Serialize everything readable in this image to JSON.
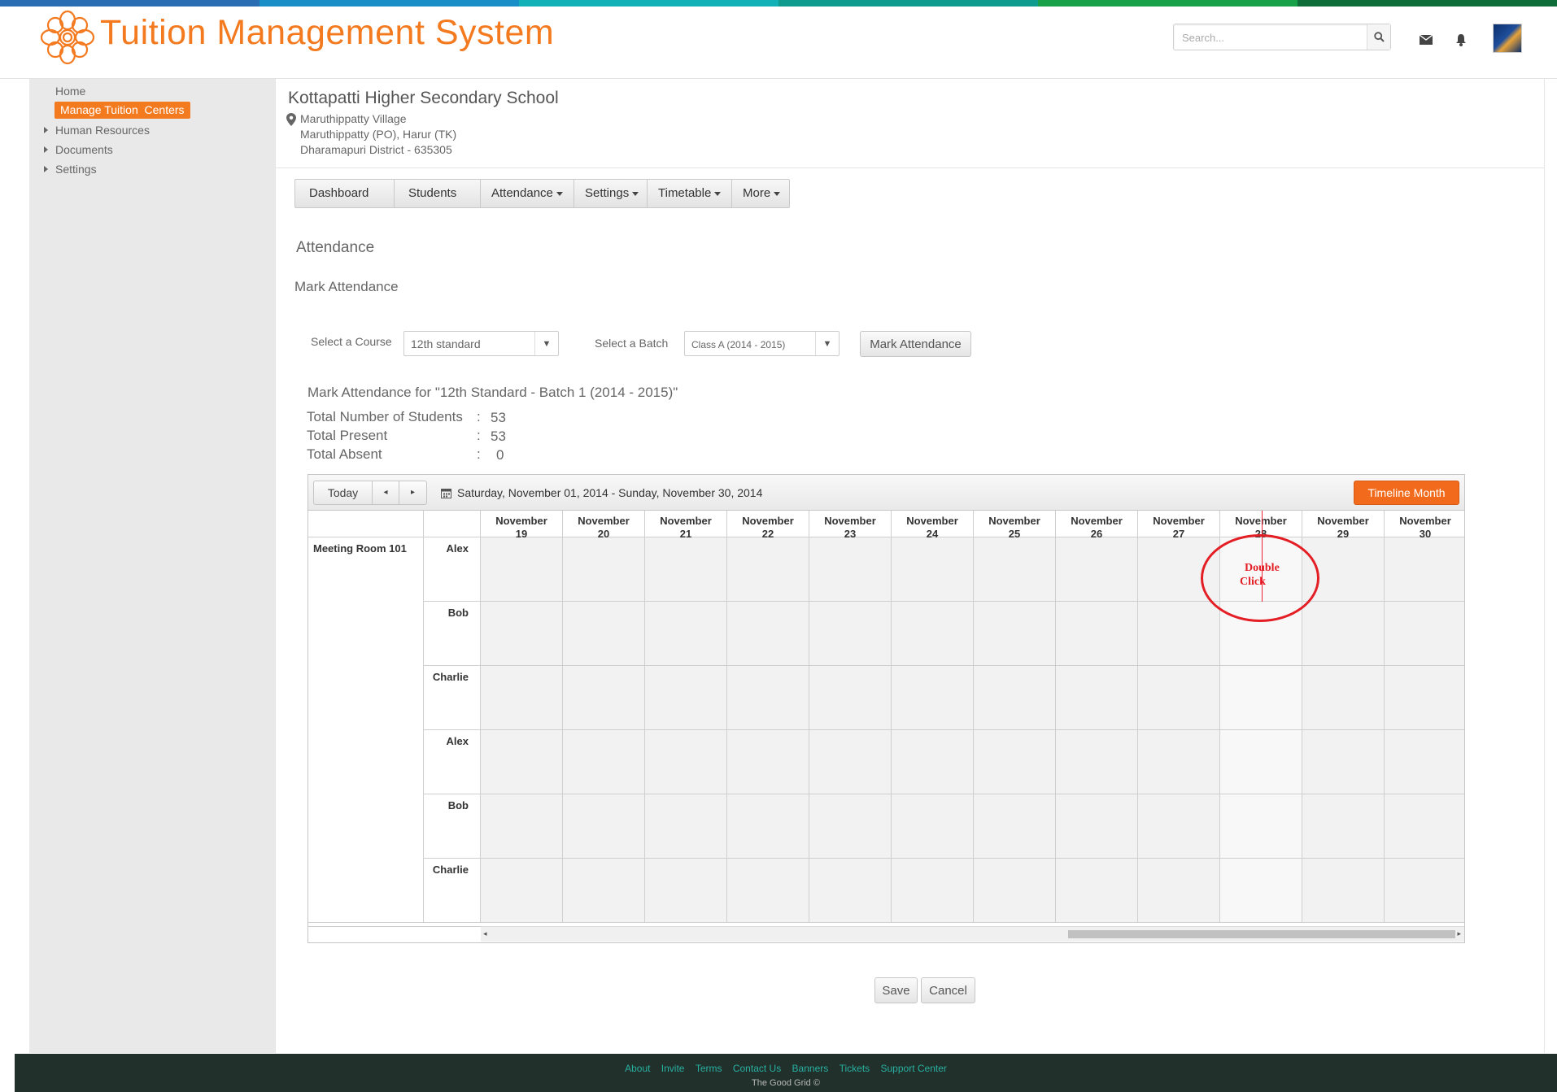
{
  "brand": {
    "title": "Tuition Management System",
    "logo_icon": "flower-logo-icon",
    "stripe_colors": [
      "#2a6db3",
      "#1a8fc7",
      "#12b1b8",
      "#0f9b8e",
      "#19a14a",
      "#0f6d3a"
    ]
  },
  "header": {
    "search_placeholder": "Search...",
    "icons": [
      "search-icon",
      "envelope-icon",
      "bell-icon"
    ]
  },
  "sidebar": {
    "home": "Home",
    "active": "Manage Tuition  Centers",
    "items": [
      "Human Resources",
      "Documents",
      "Settings"
    ]
  },
  "school": {
    "name": "Kottapatti Higher Secondary School",
    "address": [
      "Maruthippatty Village",
      "Maruthippatty (PO), Harur (TK)",
      "Dharamapuri District - 635305"
    ]
  },
  "nav": {
    "tabs": [
      "Dashboard",
      "Students",
      "Attendance",
      "Settings",
      "Timetable",
      "More"
    ],
    "has_dropdown": [
      false,
      false,
      true,
      true,
      true,
      true
    ]
  },
  "page": {
    "section": "Attendance",
    "subsection": "Mark Attendance"
  },
  "filters": {
    "course_label": "Select a Course",
    "course_value": "12th standard",
    "batch_label": "Select a Batch",
    "batch_value": "Class A (2014 - 2015)",
    "mark_button": "Mark Attendance"
  },
  "summary": {
    "heading": "Mark Attendance for \"12th Standard - Batch 1 (2014 - 2015)\"",
    "rows": [
      {
        "label": "Total Number of Students",
        "colon": ":",
        "value": "53"
      },
      {
        "label": "Total Present",
        "colon": ":",
        "value": "53"
      },
      {
        "label": "Total Absent",
        "colon": ":",
        "value": "0"
      }
    ]
  },
  "scheduler": {
    "today": "Today",
    "prev": "◂",
    "next": "▸",
    "range": "Saturday, November 01, 2014 - Sunday, November 30, 2014",
    "view": "Timeline Month",
    "room": "Meeting Room 101",
    "days": [
      {
        "month": "November",
        "day": "19"
      },
      {
        "month": "November",
        "day": "20"
      },
      {
        "month": "November",
        "day": "21"
      },
      {
        "month": "November",
        "day": "22"
      },
      {
        "month": "November",
        "day": "23"
      },
      {
        "month": "November",
        "day": "24"
      },
      {
        "month": "November",
        "day": "25"
      },
      {
        "month": "November",
        "day": "26"
      },
      {
        "month": "November",
        "day": "27"
      },
      {
        "month": "November",
        "day": "28"
      },
      {
        "month": "November",
        "day": "29"
      },
      {
        "month": "November",
        "day": "30"
      }
    ],
    "today_day": "28",
    "resources": [
      "Alex",
      "Bob",
      "Charlie",
      "Alex",
      "Bob",
      "Charlie"
    ]
  },
  "annotation": {
    "line1": "Double",
    "line2": "Click",
    "color": "#e31e24"
  },
  "actions": {
    "save": "Save",
    "cancel": "Cancel"
  },
  "footer": {
    "links": [
      "About",
      "Invite",
      "Terms",
      "Contact Us",
      "Banners",
      "Tickets",
      "Support Center"
    ],
    "copyright": "The Good Grid ©"
  }
}
